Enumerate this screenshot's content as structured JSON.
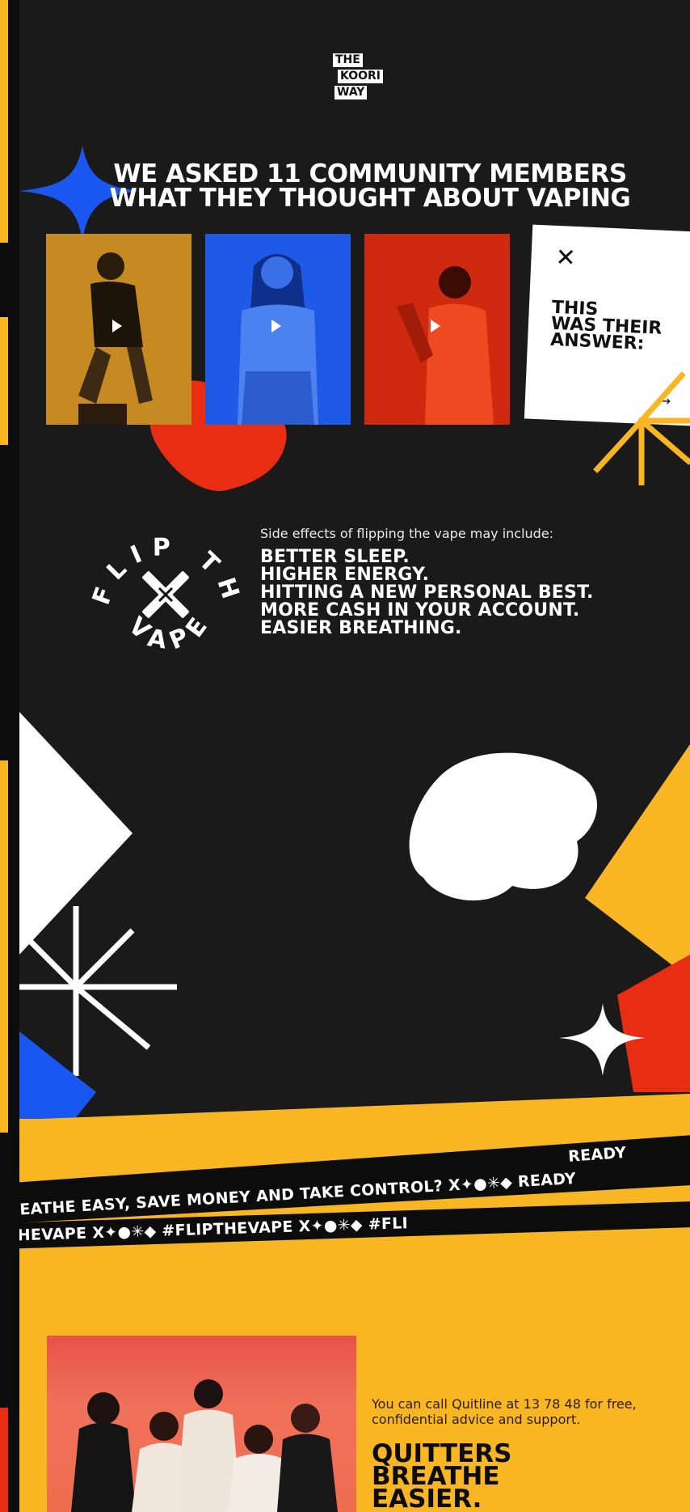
{
  "logo": {
    "line1": "THE",
    "line2": "KOORI",
    "line3": "WAY"
  },
  "headline": {
    "line1": "WE ASKED 11 COMMUNITY MEMBERS",
    "line2": "WHAT THEY THOUGHT ABOUT VAPING"
  },
  "answer_card": {
    "close_glyph": "✕",
    "title_line1": "THIS",
    "title_line2": "WAS THEIR",
    "title_line3": "ANSWER:",
    "arrow_glyph": "→"
  },
  "badge": {
    "text_top": "FLIP THE",
    "text_bottom": "VAPE"
  },
  "effects": {
    "intro": "Side effects of flipping the vape may include:",
    "items": [
      "BETTER SLEEP.",
      "HIGHER ENERGY.",
      "HITTING A NEW PERSONAL BEST.",
      "MORE CASH IN YOUR ACCOUNT.",
      "EASIER BREATHING."
    ]
  },
  "tapes": {
    "top": "READY",
    "middle": "BREATHE EASY, SAVE MONEY AND TAKE CONTROL?   X✦●✳◆   READY",
    "bottom": "PTHEVAPE   X✦●✳◆   #FLIPTHEVAPE   X✦●✳◆   #FLI"
  },
  "quitline": {
    "text": "You can call Quitline at 13 78 48 for free, confidential advice and support.",
    "title_line1": "QUITTERS",
    "title_line2": "BREATHE",
    "title_line3": "EASIER."
  },
  "colors": {
    "yellow": "#f9b623",
    "blue": "#1a56f0",
    "red": "#e82d12",
    "dark": "#1a1a1a"
  }
}
